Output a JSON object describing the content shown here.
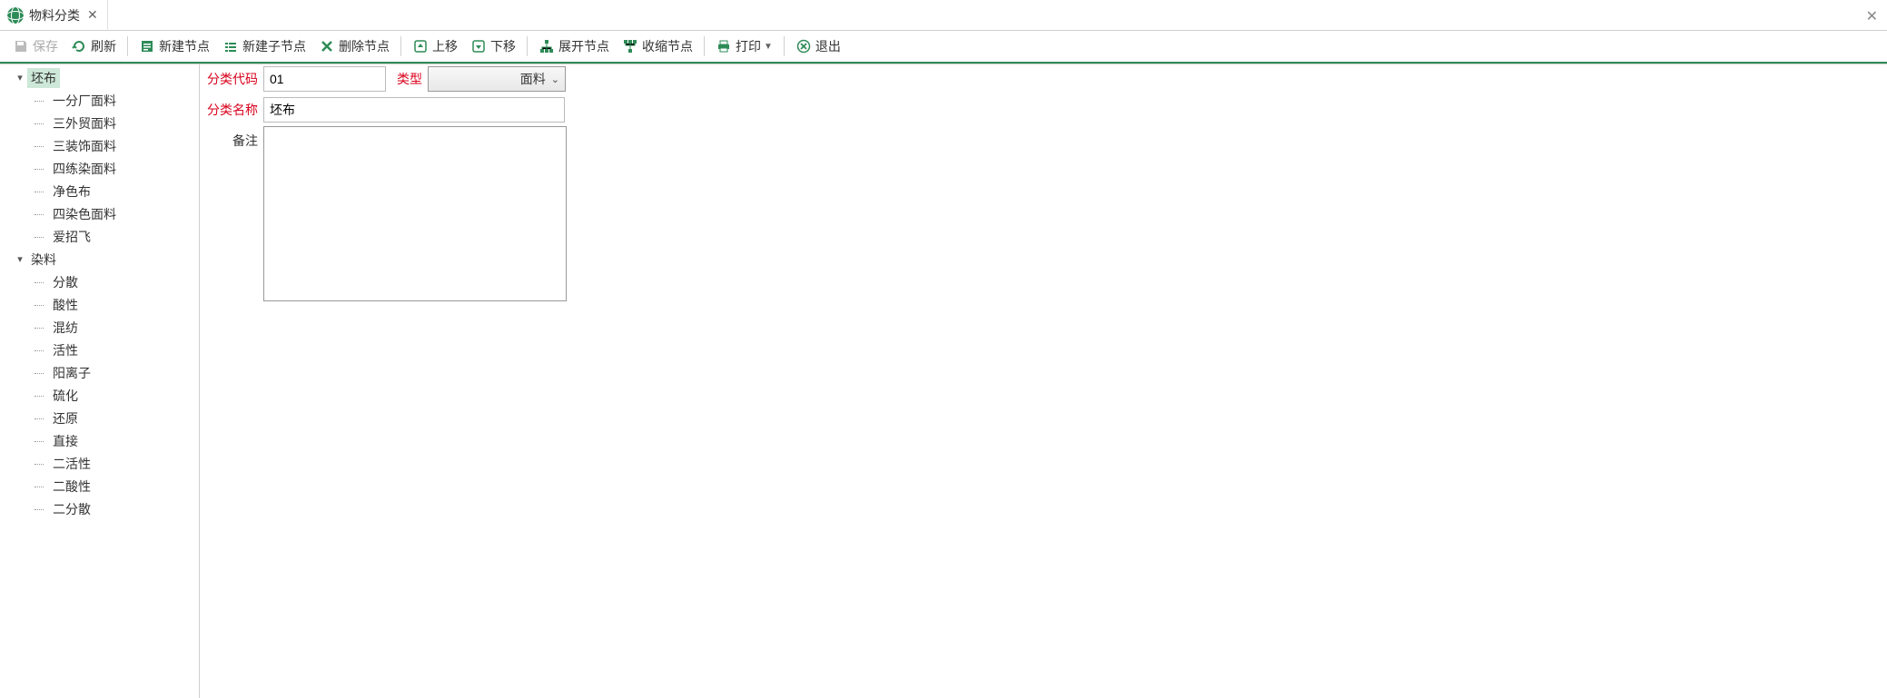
{
  "tab": {
    "title": "物料分类"
  },
  "toolbar": {
    "save": "保存",
    "refresh": "刷新",
    "new_node": "新建节点",
    "new_child": "新建子节点",
    "delete_node": "删除节点",
    "move_up": "上移",
    "move_down": "下移",
    "expand": "展开节点",
    "collapse": "收缩节点",
    "print": "打印",
    "exit": "退出"
  },
  "tree": {
    "root1": {
      "label": "坯布"
    },
    "root1_children": [
      "一分厂面料",
      "三外贸面料",
      "三装饰面料",
      "四练染面料",
      "净色布",
      "四染色面料",
      "爱招飞"
    ],
    "root2": {
      "label": "染料"
    },
    "root2_children": [
      "分散",
      "酸性",
      "混纺",
      "活性",
      "阳离子",
      "硫化",
      "还原",
      "直接",
      "二活性",
      "二酸性",
      "二分散"
    ]
  },
  "form": {
    "labels": {
      "code": "分类代码",
      "type": "类型",
      "name": "分类名称",
      "remark": "备注"
    },
    "values": {
      "code": "01",
      "type": "面料",
      "name": "坯布",
      "remark": ""
    }
  }
}
